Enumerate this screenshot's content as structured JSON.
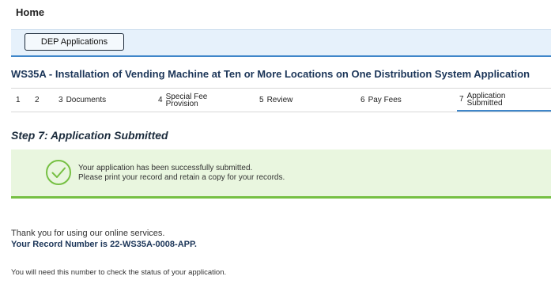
{
  "header": {
    "home": "Home"
  },
  "dep_button": "DEP Applications",
  "application_title": "WS35A - Installation of Vending Machine at Ten or More Locations on One Distribution System Application",
  "steps": [
    {
      "num": "1",
      "label": ""
    },
    {
      "num": "2",
      "label": ""
    },
    {
      "num": "3",
      "label": "Documents"
    },
    {
      "num": "4",
      "label_line1": "Special Fee",
      "label_line2": "Provision"
    },
    {
      "num": "5",
      "label": "Review"
    },
    {
      "num": "6",
      "label": "Pay Fees"
    },
    {
      "num": "7",
      "label_line1": "Application",
      "label_line2": "Submitted"
    }
  ],
  "step_heading": "Step 7: Application Submitted",
  "success": {
    "line1": "Your application has been successfully submitted.",
    "line2": "Please print your record and retain a copy for your records.",
    "icon": "check-circle-icon",
    "color": "#76c043"
  },
  "thanks": "Thank you for using our online services.",
  "record_number": "Your Record Number is 22-WS35A-0008-APP.",
  "note": "You will need this number to check the status of your application."
}
